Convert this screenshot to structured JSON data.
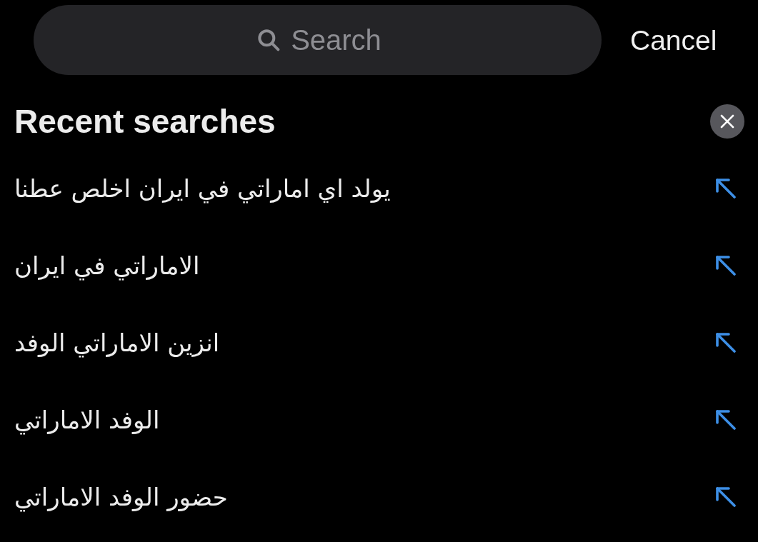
{
  "search": {
    "placeholder": "Search"
  },
  "cancel_button": "Cancel",
  "recent_searches": {
    "title": "Recent searches",
    "items": [
      {
        "text": "يولد اي اماراتي في ايران اخلص عطنا"
      },
      {
        "text": "الاماراتي في ايران"
      },
      {
        "text": "انزين الاماراتي الوفد"
      },
      {
        "text": "الوفد الاماراتي"
      },
      {
        "text": "حضور الوفد الاماراتي"
      }
    ]
  }
}
